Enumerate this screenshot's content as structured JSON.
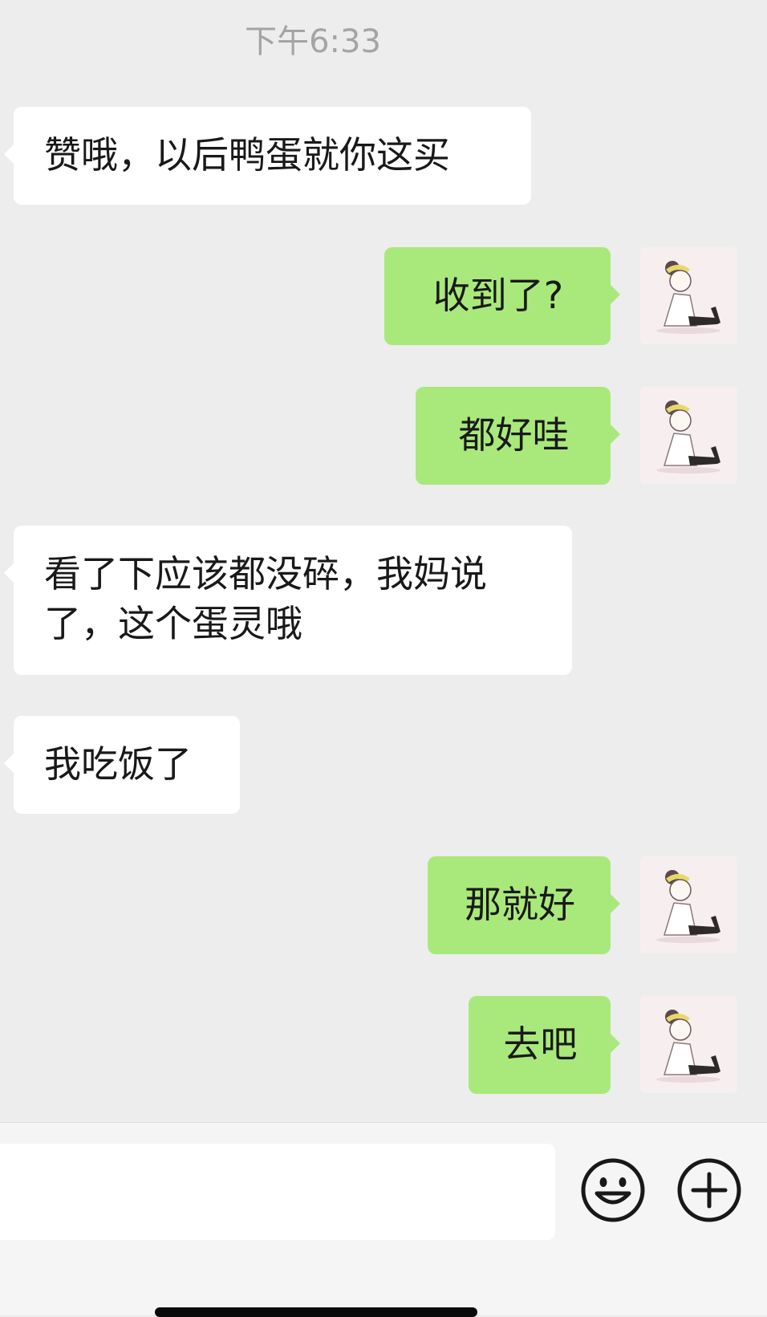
{
  "chat": {
    "timestamp": "下午6:33",
    "messages": [
      {
        "side": "in",
        "text": "赞哦，以后鸭蛋就你这买"
      },
      {
        "side": "out",
        "text": "收到了?"
      },
      {
        "side": "out",
        "text": "都好哇"
      },
      {
        "side": "in",
        "text": "看了下应该都没碎，我妈说\n了，这个蛋灵哦"
      },
      {
        "side": "in",
        "text": "我吃饭了"
      },
      {
        "side": "out",
        "text": "那就好"
      },
      {
        "side": "out",
        "text": "去吧"
      }
    ]
  },
  "input_bar": {
    "message_value": "",
    "emoji_button_icon": "smiley-face-icon",
    "more_button_icon": "plus-circle-icon"
  },
  "colors": {
    "chat_background": "#ededed",
    "incoming_bubble": "#ffffff",
    "outgoing_bubble": "#a9e97b",
    "timestamp_text": "#a4a4a4",
    "input_bar_background": "#f5f5f5"
  }
}
